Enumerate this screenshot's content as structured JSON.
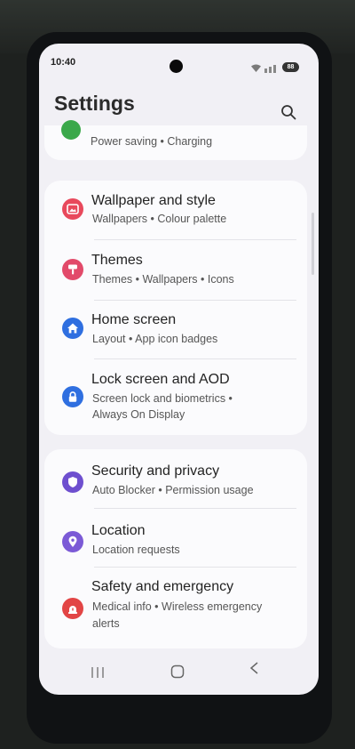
{
  "status_bar": {
    "time": "10:40",
    "battery": "88"
  },
  "header": {
    "title": "Settings"
  },
  "partial_item": {
    "subtitle": "Power saving  •  Charging"
  },
  "groups": [
    {
      "items": [
        {
          "title": "Wallpaper and style",
          "subtitle": [
            "Wallpapers  •  Colour palette"
          ],
          "icon": "wallpaper-icon",
          "color": "#e8495c"
        },
        {
          "title": "Themes",
          "subtitle": [
            "Themes  •  Wallpapers  •  Icons"
          ],
          "icon": "themes-brush-icon",
          "color": "#e24a6a"
        },
        {
          "title": "Home screen",
          "subtitle": [
            "Layout  •  App icon badges"
          ],
          "icon": "home-icon",
          "color": "#2f6fe0"
        },
        {
          "title": "Lock screen and AOD",
          "subtitle": [
            "Screen lock and biometrics  •",
            "Always On Display"
          ],
          "icon": "lock-icon",
          "color": "#2f6fe0"
        }
      ]
    },
    {
      "items": [
        {
          "title": "Security and privacy",
          "subtitle": [
            "Auto Blocker  •  Permission usage"
          ],
          "icon": "shield-icon",
          "color": "#6e4fcf"
        },
        {
          "title": "Location",
          "subtitle": [
            "Location requests"
          ],
          "icon": "location-pin-icon",
          "color": "#7b5ad6"
        },
        {
          "title": "Safety and emergency",
          "subtitle": [
            "Medical info  •  Wireless emergency",
            "alerts"
          ],
          "icon": "emergency-icon",
          "color": "#e24545"
        }
      ]
    }
  ],
  "nav_bar": {
    "recents": "recents-icon",
    "home": "home-button-icon",
    "back": "back-icon"
  },
  "colors": {
    "screen_bg": "#f1f0f5",
    "card_bg": "#fbfbfd",
    "text": "#232323",
    "subtext": "#555555"
  }
}
